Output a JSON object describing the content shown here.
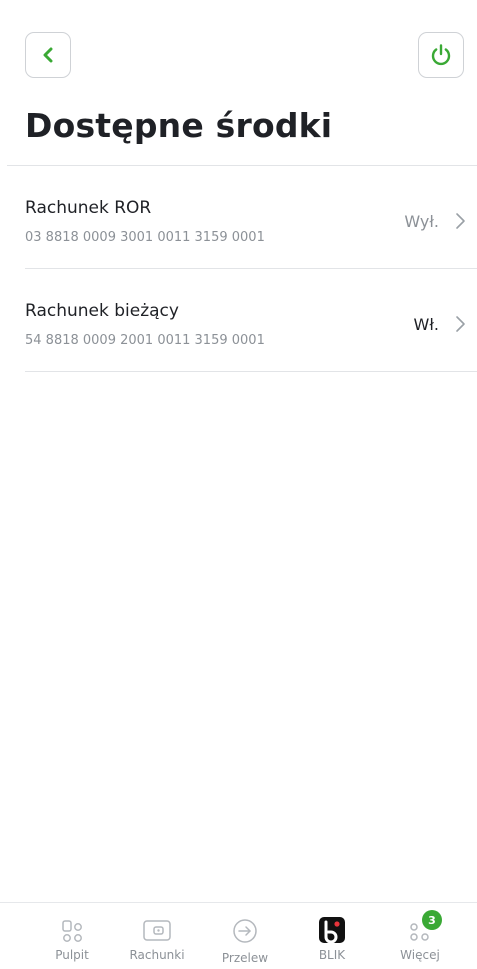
{
  "header": {
    "back_icon": "chevron-left-icon",
    "power_icon": "power-icon",
    "title": "Dostępne środki"
  },
  "accounts": [
    {
      "name": "Rachunek ROR",
      "number": "03 8818 0009 3001 0011 3159 0001",
      "status": "Wył."
    },
    {
      "name": "Rachunek bieżący",
      "number": "54 8818 0009 2001 0011 3159 0001",
      "status": "Wł."
    }
  ],
  "nav": {
    "items": [
      {
        "label": "Pulpit",
        "icon": "dashboard-icon"
      },
      {
        "label": "Rachunki",
        "icon": "wallet-icon"
      },
      {
        "label": "Przelew",
        "icon": "arrow-circle-icon"
      },
      {
        "label": "BLIK",
        "icon": "blik-icon"
      },
      {
        "label": "Więcej",
        "icon": "more-dots-icon",
        "badge": "3"
      }
    ]
  },
  "colors": {
    "accent": "#3aa935",
    "text": "#1f2126",
    "muted": "#8c9197"
  }
}
